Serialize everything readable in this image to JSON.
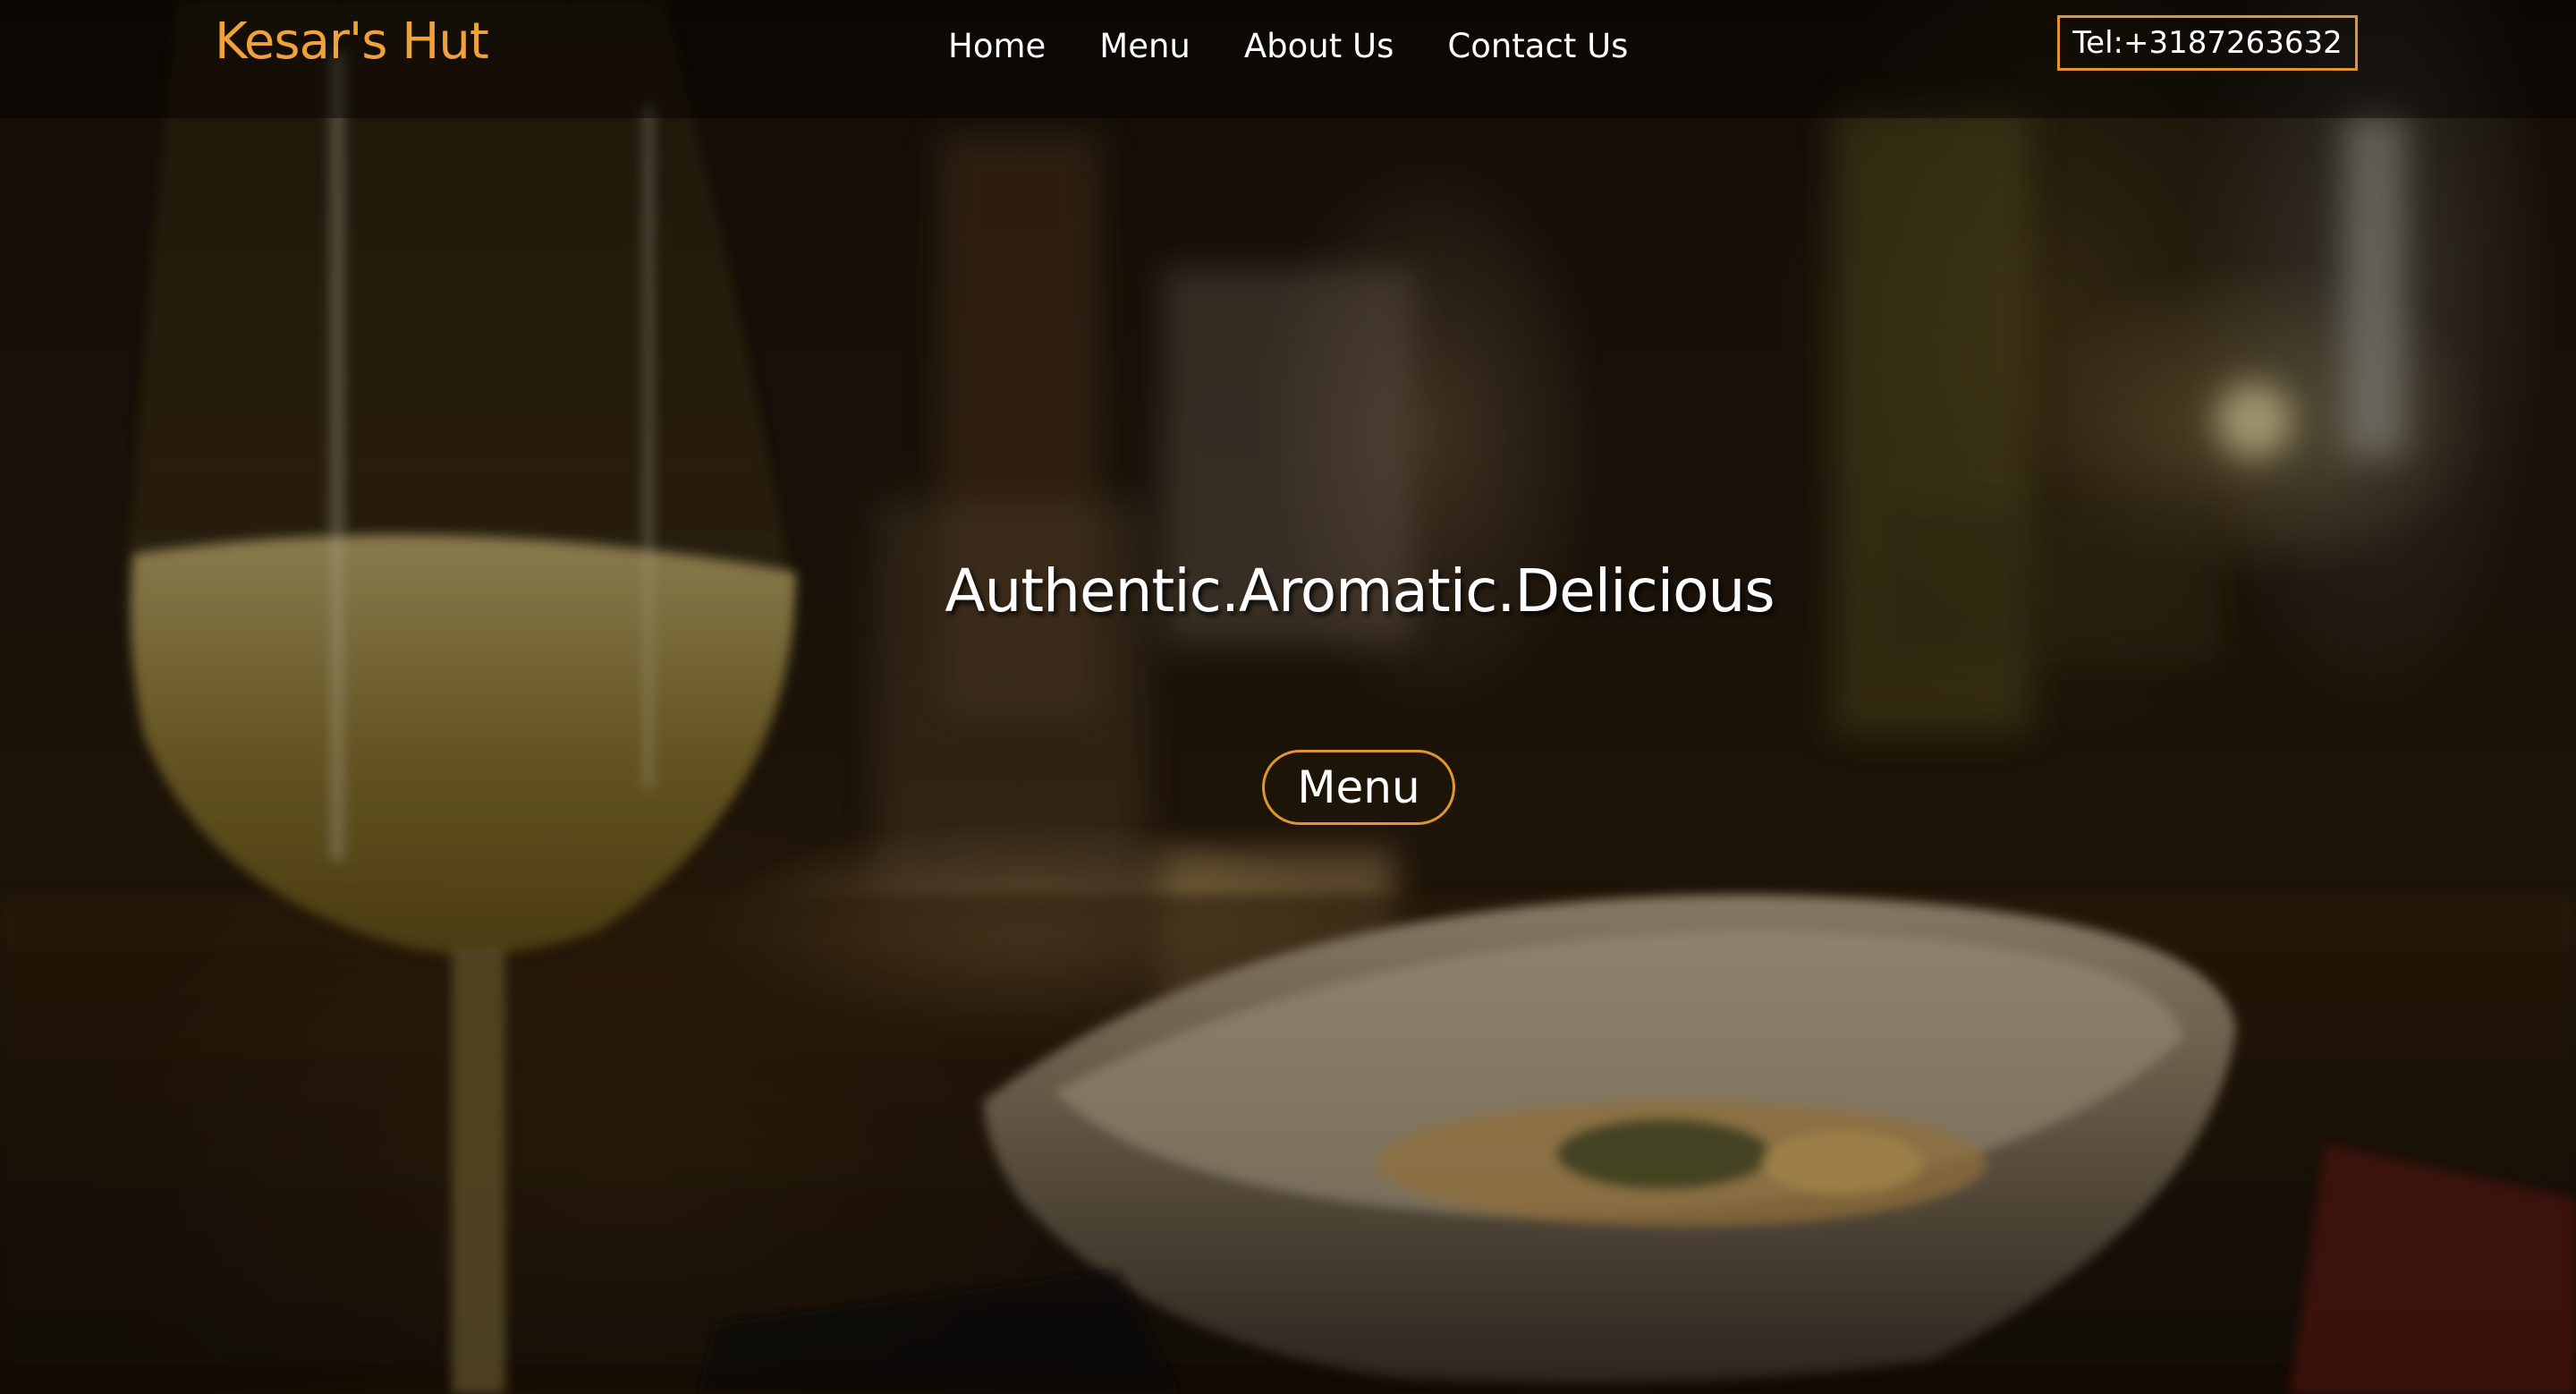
{
  "header": {
    "brand": "Kesar's Hut",
    "nav": [
      {
        "label": "Home"
      },
      {
        "label": "Menu"
      },
      {
        "label": "About Us"
      },
      {
        "label": "Contact Us"
      }
    ],
    "phone": "Tel:+3187263632"
  },
  "hero": {
    "tagline": "Authentic.Aromatic.Delicious",
    "button_label": "Menu",
    "background": "restaurant-table-wine-glass-bowl-image"
  },
  "colors": {
    "accent": "#f0a13a",
    "border": "#e2952f",
    "text": "#ffffff"
  }
}
